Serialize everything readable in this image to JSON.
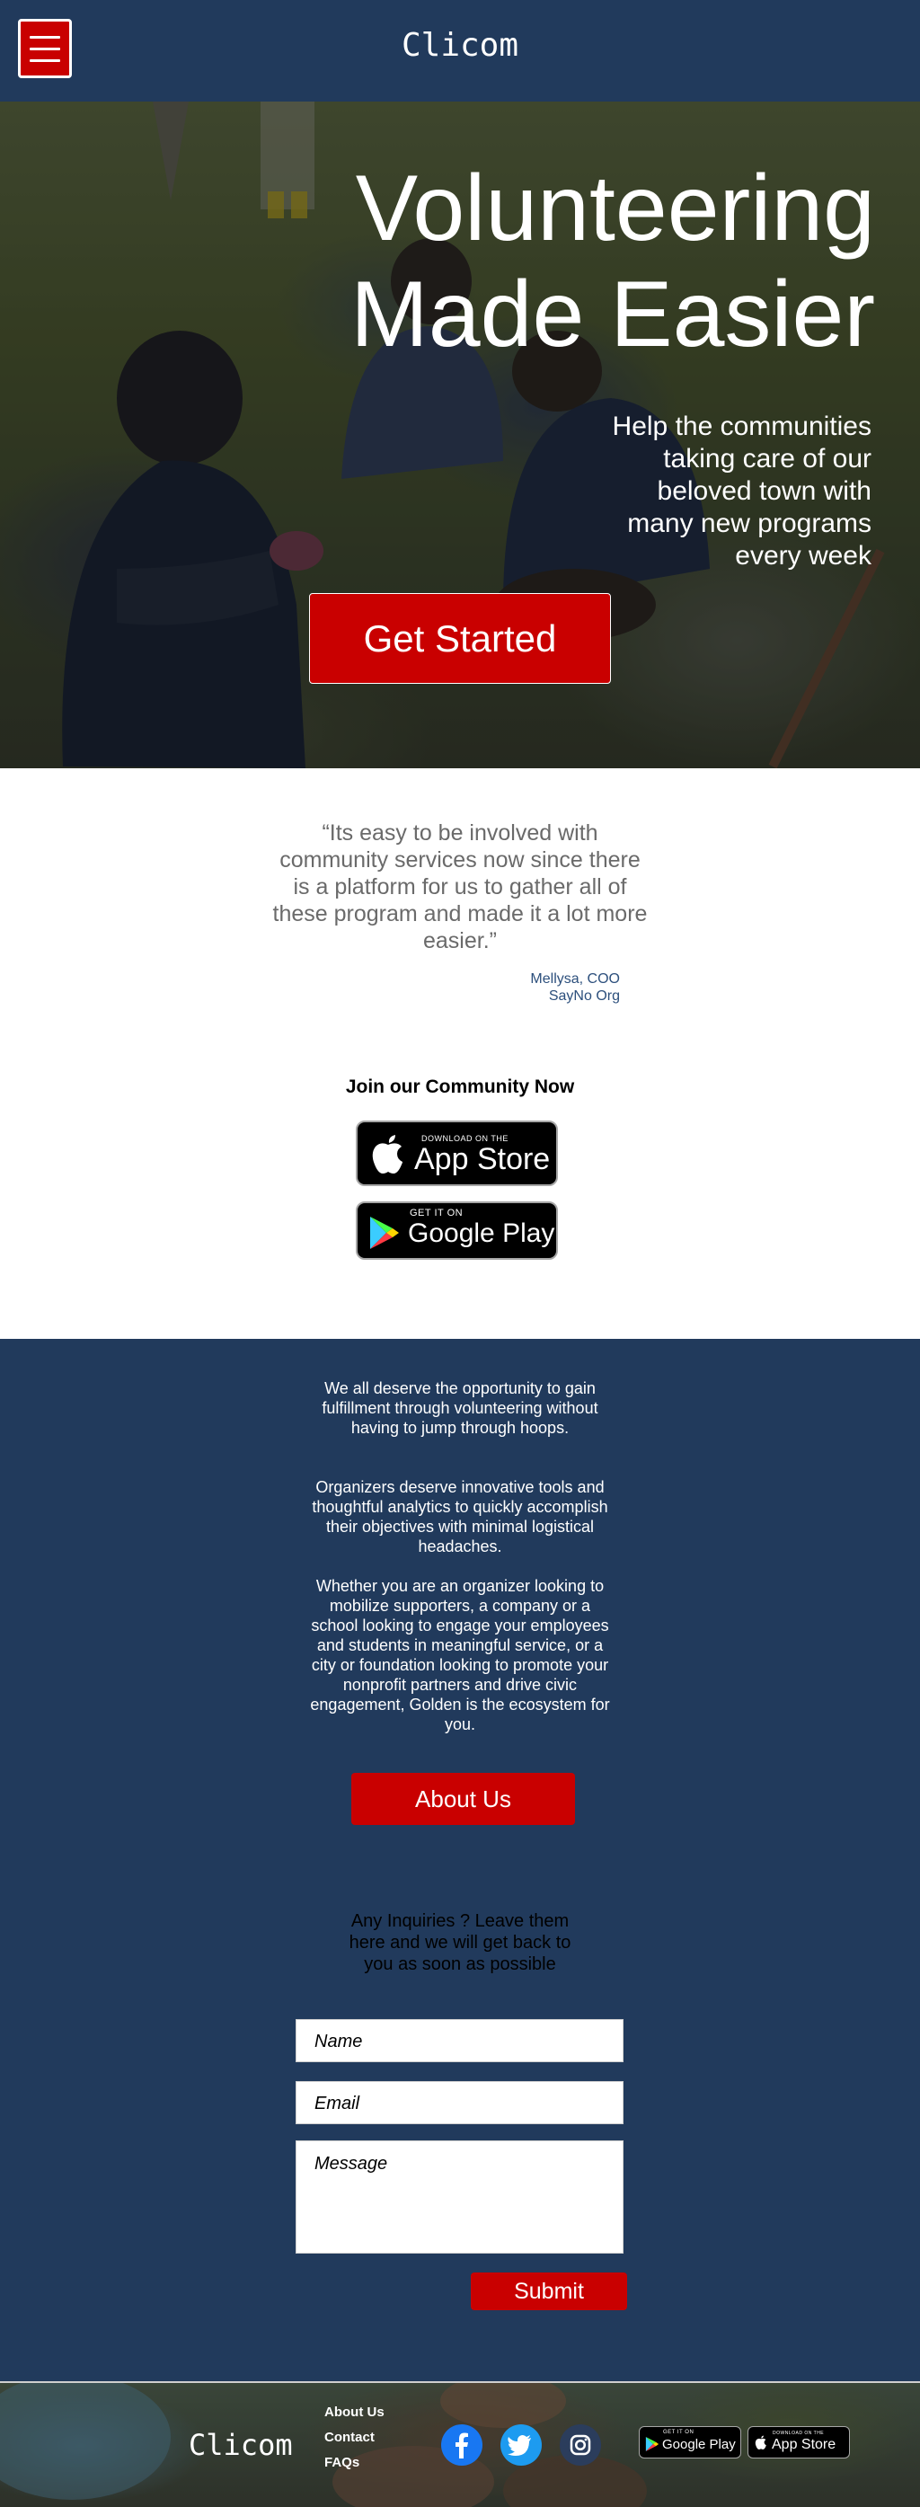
{
  "header": {
    "logo": "Clicom",
    "menu_icon": "hamburger-menu-icon"
  },
  "hero": {
    "title_line1": "Volunteering",
    "title_line2": "Made Easier",
    "subtitle": "Help the communities taking care of our beloved town with many new programs every week",
    "cta_label": "Get Started"
  },
  "testimonial": {
    "quote": "“Its easy to be involved with community services now since there is a platform for us to gather all of these program and made it a lot more easier.”",
    "author_line1": "Mellysa, COO",
    "author_line2": "SayNo Org"
  },
  "community": {
    "title": "Join our Community Now",
    "app_store_small": "DOWNLOAD ON THE",
    "app_store_big": "App Store",
    "google_play_small": "GET IT ON",
    "google_play_big": "Google Play"
  },
  "about": {
    "paragraph1": "We all deserve the opportunity to gain fulfillment through volunteering without having to jump through hoops.",
    "paragraph2": "Organizers deserve innovative tools and thoughtful analytics to quickly accomplish their objectives with minimal logistical headaches.",
    "paragraph3": "Whether you are an organizer looking to mobilize supporters, a company or a school looking to engage your employees and students in meaningful service, or a city or foundation looking to promote your nonprofit partners and drive civic engagement, Golden is the ecosystem for you.",
    "button_label": "About Us"
  },
  "contact": {
    "intro": "Any Inquiries ? Leave them here and we will get back to you as soon as possible",
    "name_placeholder": "Name",
    "email_placeholder": "Email",
    "message_placeholder": "Message",
    "submit_label": "Submit"
  },
  "footer": {
    "logo": "Clicom",
    "links": [
      "About Us",
      "Contact",
      "FAQs"
    ],
    "social_icons": [
      "facebook-icon",
      "twitter-icon",
      "instagram-icon"
    ],
    "google_play_small": "GET IT ON",
    "google_play_big": "Google Play",
    "app_store_small": "DOWNLOAD ON THE",
    "app_store_big": "App Store"
  },
  "colors": {
    "navy": "#213a5c",
    "accent_red": "#c90000",
    "author_blue": "#2c4f7c"
  }
}
